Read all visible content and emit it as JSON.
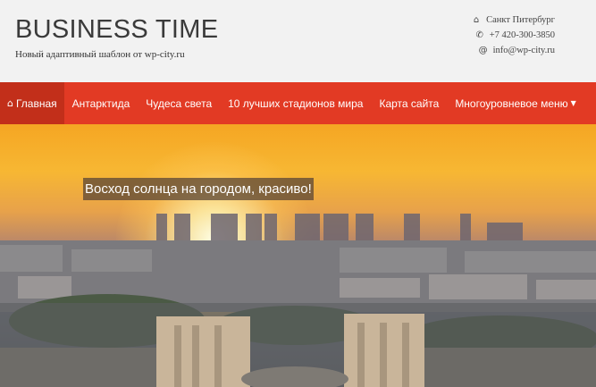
{
  "header": {
    "site_title": "BUSINESS TIME",
    "tagline": "Новый адаптивный шаблон от wp-city.ru",
    "contacts": [
      {
        "icon": "home-icon",
        "text": "Санкт Питербург"
      },
      {
        "icon": "phone-icon",
        "text": "+7 420-300-3850"
      },
      {
        "icon": "at-icon",
        "text": "info@wp-city.ru"
      }
    ]
  },
  "nav": {
    "items": [
      {
        "label": "Главная",
        "active": true
      },
      {
        "label": "Антарктида"
      },
      {
        "label": "Чудеса света"
      },
      {
        "label": "10 лучших стадионов мира"
      },
      {
        "label": "Карта сайта"
      },
      {
        "label": "Многоуровневое меню"
      }
    ]
  },
  "hero": {
    "caption": "Восход солнца на городом, красиво!"
  },
  "colors": {
    "nav_bg": "#e23a24",
    "nav_active_bg": "#c22f1a",
    "header_bg": "#f2f2f2"
  }
}
